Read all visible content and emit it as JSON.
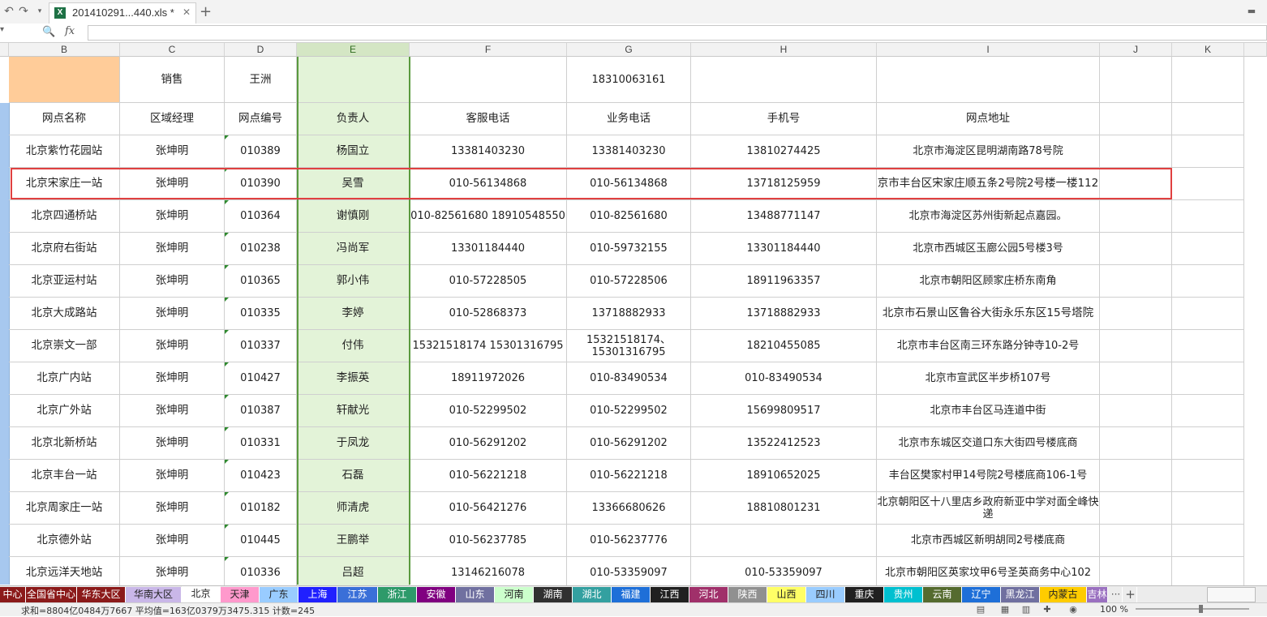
{
  "titlebar": {
    "tab_title": "201410291...440.xls *",
    "tab_icon": "X",
    "close": "✕",
    "new_tab": "+",
    "undo": "↶",
    "redo": "↷",
    "fx": "fx",
    "zoom_icon": "🔍"
  },
  "columns": [
    "B",
    "C",
    "D",
    "E",
    "F",
    "G",
    "H",
    "I",
    "J",
    "K"
  ],
  "top_row": {
    "c": "销售",
    "d": "王洲",
    "g": "18310063161"
  },
  "header_row": [
    "网点名称",
    "区域经理",
    "网点编号",
    "负责人",
    "客服电话",
    "业务电话",
    "手机号",
    "网点地址"
  ],
  "rows": [
    {
      "name": "北京紫竹花园站",
      "mgr": "张坤明",
      "code": "010389",
      "owner": "杨国立",
      "cs": "13381403230",
      "biz": "13381403230",
      "mobile": "13810274425",
      "addr": "北京市海淀区昆明湖南路78号院"
    },
    {
      "name": "北京宋家庄一站",
      "mgr": "张坤明",
      "code": "010390",
      "owner": "吴雪",
      "cs": "010-56134868",
      "biz": "010-56134868",
      "mobile": "13718125959",
      "addr": "京市丰台区宋家庄顺五条2号院2号楼一楼112"
    },
    {
      "name": "北京四通桥站",
      "mgr": "张坤明",
      "code": "010364",
      "owner": "谢慎刚",
      "cs": "010-82561680 18910548550",
      "biz": "010-82561680",
      "mobile": "13488771147",
      "addr": "北京市海淀区苏州街新起点嘉园。"
    },
    {
      "name": "北京府右街站",
      "mgr": "张坤明",
      "code": "010238",
      "owner": "冯尚军",
      "cs": "13301184440",
      "biz": "010-59732155",
      "mobile": "13301184440",
      "addr": "北京市西城区玉廊公园5号楼3号"
    },
    {
      "name": "北京亚运村站",
      "mgr": "张坤明",
      "code": "010365",
      "owner": "郭小伟",
      "cs": "010-57228505",
      "biz": "010-57228506",
      "mobile": "18911963357",
      "addr": "北京市朝阳区顾家庄桥东南角"
    },
    {
      "name": "北京大成路站",
      "mgr": "张坤明",
      "code": "010335",
      "owner": "李婷",
      "cs": "010-52868373",
      "biz": "13718882933",
      "mobile": "13718882933",
      "addr": "北京市石景山区鲁谷大街永乐东区15号塔院"
    },
    {
      "name": "北京崇文一部",
      "mgr": "张坤明",
      "code": "010337",
      "owner": "付伟",
      "cs": "15321518174 15301316795",
      "biz": "15321518174、 15301316795",
      "mobile": "18210455085",
      "addr": "北京市丰台区南三环东路分钟寺10-2号"
    },
    {
      "name": "北京广内站",
      "mgr": "张坤明",
      "code": "010427",
      "owner": "李振英",
      "cs": "18911972026",
      "biz": "010-83490534",
      "mobile": "010-83490534",
      "addr": "北京市宣武区半步桥107号"
    },
    {
      "name": "北京广外站",
      "mgr": "张坤明",
      "code": "010387",
      "owner": "轩献光",
      "cs": "010-52299502",
      "biz": "010-52299502",
      "mobile": "15699809517",
      "addr": "北京市丰台区马连道中街"
    },
    {
      "name": "北京北新桥站",
      "mgr": "张坤明",
      "code": "010331",
      "owner": "于凤龙",
      "cs": "010-56291202",
      "biz": "010-56291202",
      "mobile": "13522412523",
      "addr": "北京市东城区交道口东大街四号楼底商"
    },
    {
      "name": "北京丰台一站",
      "mgr": "张坤明",
      "code": "010423",
      "owner": "石磊",
      "cs": "010-56221218",
      "biz": "010-56221218",
      "mobile": "18910652025",
      "addr": "丰台区樊家村甲14号院2号楼底商106-1号"
    },
    {
      "name": "北京周家庄一站",
      "mgr": "张坤明",
      "code": "010182",
      "owner": "师清虎",
      "cs": "010-56421276",
      "biz": "13366680626",
      "mobile": "18810801231",
      "addr": "北京朝阳区十八里店乡政府新亚中学对面全峰快递"
    },
    {
      "name": "北京德外站",
      "mgr": "张坤明",
      "code": "010445",
      "owner": "王鹏举",
      "cs": "010-56237785",
      "biz": "010-56237776",
      "mobile": "",
      "addr": "北京市西城区新明胡同2号楼底商"
    },
    {
      "name": "北京远洋天地站",
      "mgr": "张坤明",
      "code": "010336",
      "owner": "吕超",
      "cs": "13146216078",
      "biz": "010-53359097",
      "mobile": "010-53359097",
      "addr": "北京市朝阳区英家坟甲6号圣英商务中心102"
    }
  ],
  "sheets": [
    {
      "label": "中心",
      "color": "#8b1a1a"
    },
    {
      "label": "全国省中心",
      "color": "#8b1a1a"
    },
    {
      "label": "华东大区",
      "color": "#8b1a1a"
    },
    {
      "label": "华南大区",
      "color": "#c9b7e8"
    },
    {
      "label": "北京",
      "color": "#ffffff"
    },
    {
      "label": "天津",
      "color": "#ff99cc"
    },
    {
      "label": "广东",
      "color": "#99ccff"
    },
    {
      "label": "上海",
      "color": "#2020ff"
    },
    {
      "label": "江苏",
      "color": "#3a6fd8"
    },
    {
      "label": "浙江",
      "color": "#2e9a6a"
    },
    {
      "label": "安徽",
      "color": "#800080"
    },
    {
      "label": "山东",
      "color": "#7070a0"
    },
    {
      "label": "河南",
      "color": "#ccffcc"
    },
    {
      "label": "湖南",
      "color": "#303030"
    },
    {
      "label": "湖北",
      "color": "#33a0a0"
    },
    {
      "label": "福建",
      "color": "#1e6fd8"
    },
    {
      "label": "江西",
      "color": "#202020"
    },
    {
      "label": "河北",
      "color": "#a0306a"
    },
    {
      "label": "陕西",
      "color": "#909090"
    },
    {
      "label": "山西",
      "color": "#ffff66"
    },
    {
      "label": "四川",
      "color": "#99ccff"
    },
    {
      "label": "重庆",
      "color": "#202020"
    },
    {
      "label": "贵州",
      "color": "#00c0d0"
    },
    {
      "label": "云南",
      "color": "#556b2f"
    },
    {
      "label": "辽宁",
      "color": "#1e6fd8"
    },
    {
      "label": "黑龙江",
      "color": "#7070a0"
    },
    {
      "label": "内蒙古",
      "color": "#ffcc00"
    },
    {
      "label": "吉林",
      "color": "#9a70c0"
    }
  ],
  "sheet_more": "···",
  "sheet_add": "+",
  "status": {
    "summary": "求和=8804亿0484万7667  平均值=163亿0379万3475.315  计数=245",
    "zoom": "100 %"
  }
}
